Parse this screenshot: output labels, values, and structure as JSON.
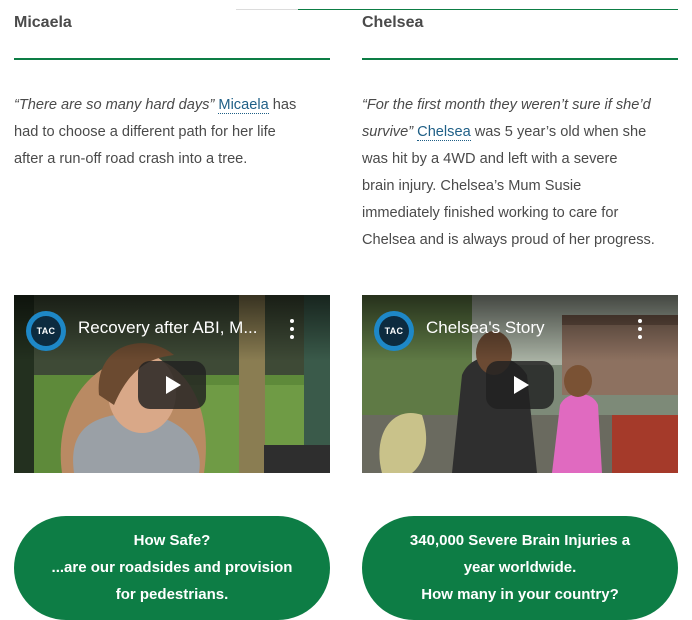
{
  "colors": {
    "accent_green": "#0d7d45",
    "link_blue": "#1f5f86",
    "text_gray": "#4a4a4a"
  },
  "profiles": [
    {
      "name": "Micaela",
      "quote": "“There are so many hard days”",
      "link_text": "Micaela",
      "body_lines": [
        "has",
        "had to choose a different path for her life",
        "after a run-off road crash into a tree."
      ],
      "video": {
        "channel_logo": "TAC",
        "title": "Recovery after ABI, M...",
        "menu_icon": "more-vert-icon",
        "play_icon": "play-icon"
      },
      "cta_lines": [
        "How Safe?",
        "...are our roadsides and provision",
        "for pedestrians."
      ]
    },
    {
      "name": "Chelsea",
      "quote_line1": "“For the first month they weren’t sure if she’d",
      "quote_line2": "survive”",
      "link_text": "Chelsea",
      "body_lines": [
        "was 5 year’s old when she",
        "was hit by a 4WD and left with a severe",
        "brain injury.  Chelsea’s Mum Susie",
        "immediately finished working to care for",
        "Chelsea and is always proud of her progress."
      ],
      "video": {
        "channel_logo": "TAC",
        "title": "Chelsea's Story",
        "menu_icon": "more-vert-icon",
        "play_icon": "play-icon"
      },
      "cta_lines": [
        "340,000 Severe Brain Injuries a",
        "year worldwide.",
        "How many in your country?"
      ]
    }
  ]
}
